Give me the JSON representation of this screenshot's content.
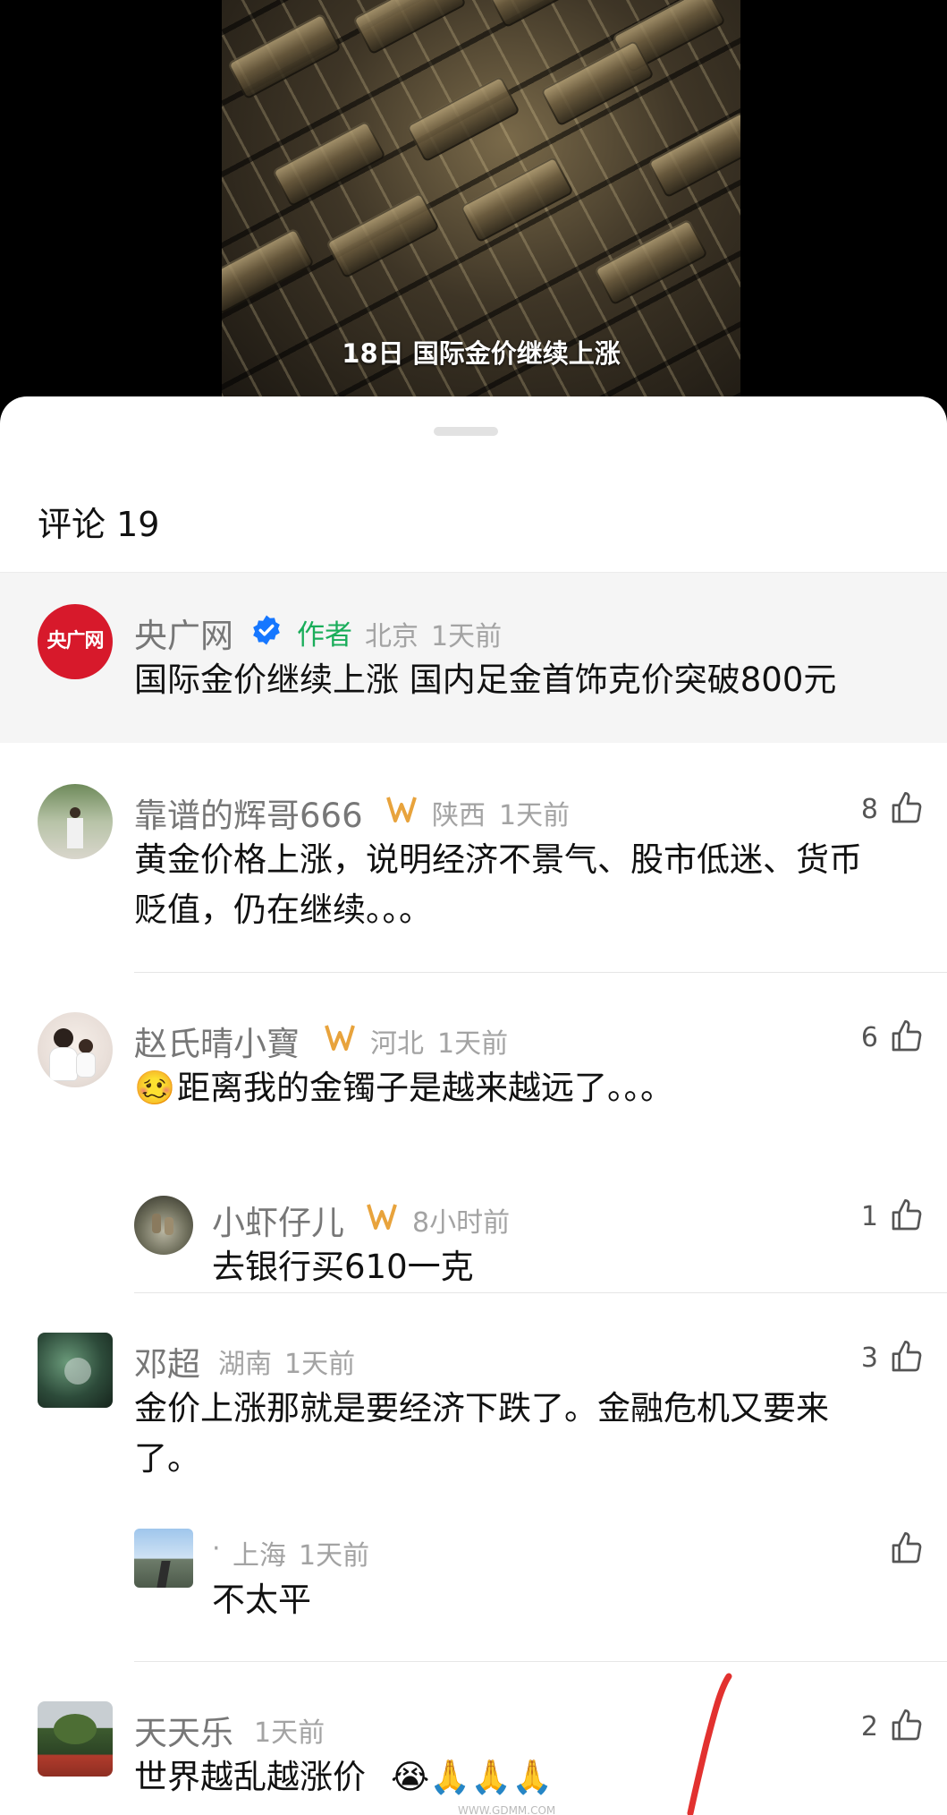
{
  "video": {
    "caption": "18日 国际金价继续上涨"
  },
  "comments_header": "评论 19",
  "pinned": {
    "avatar_text": "央广网",
    "name": "央广网",
    "author_badge": "作者",
    "location": "北京",
    "time": "1天前",
    "text": "国际金价继续上涨 国内足金首饰克价突破800元"
  },
  "comments": [
    {
      "name": "靠谱的辉哥666",
      "location": "陕西",
      "time": "1天前",
      "likes": "8",
      "text_line1": "黄金价格上涨，说明经济不景气、股市低迷、货币",
      "text_line2": "贬值，仍在继续。。。"
    },
    {
      "name": "赵氏晴小寶",
      "location": "河北",
      "time": "1天前",
      "likes": "6",
      "emoji": "🥴",
      "text_line1": "距离我的金镯子是越来越远了。。。",
      "reply": {
        "name": "小虾仔儿",
        "time": "8小时前",
        "likes": "1",
        "text": "去银行买610一克"
      }
    },
    {
      "name": "邓超",
      "location": "湖南",
      "time": "1天前",
      "likes": "3",
      "text_line1": "金价上涨那就是要经济下跌了。金融危机又要来",
      "text_line2": "了。",
      "reply": {
        "dot": "·",
        "location": "上海",
        "time": "1天前",
        "text": "不太平"
      }
    },
    {
      "name": "天天乐",
      "time": "1天前",
      "likes": "2",
      "text_line1": "世界越乱越涨价",
      "emojis": "😭🙏🙏🙏"
    }
  ],
  "watermark": "WWW.GDMM.COM",
  "colors": {
    "accent_green": "#1aad5a",
    "verified_blue": "#1677ff",
    "vip_gold": "#e8a33c",
    "brand_red": "#d7192b",
    "annotation_red": "#e2312f"
  }
}
